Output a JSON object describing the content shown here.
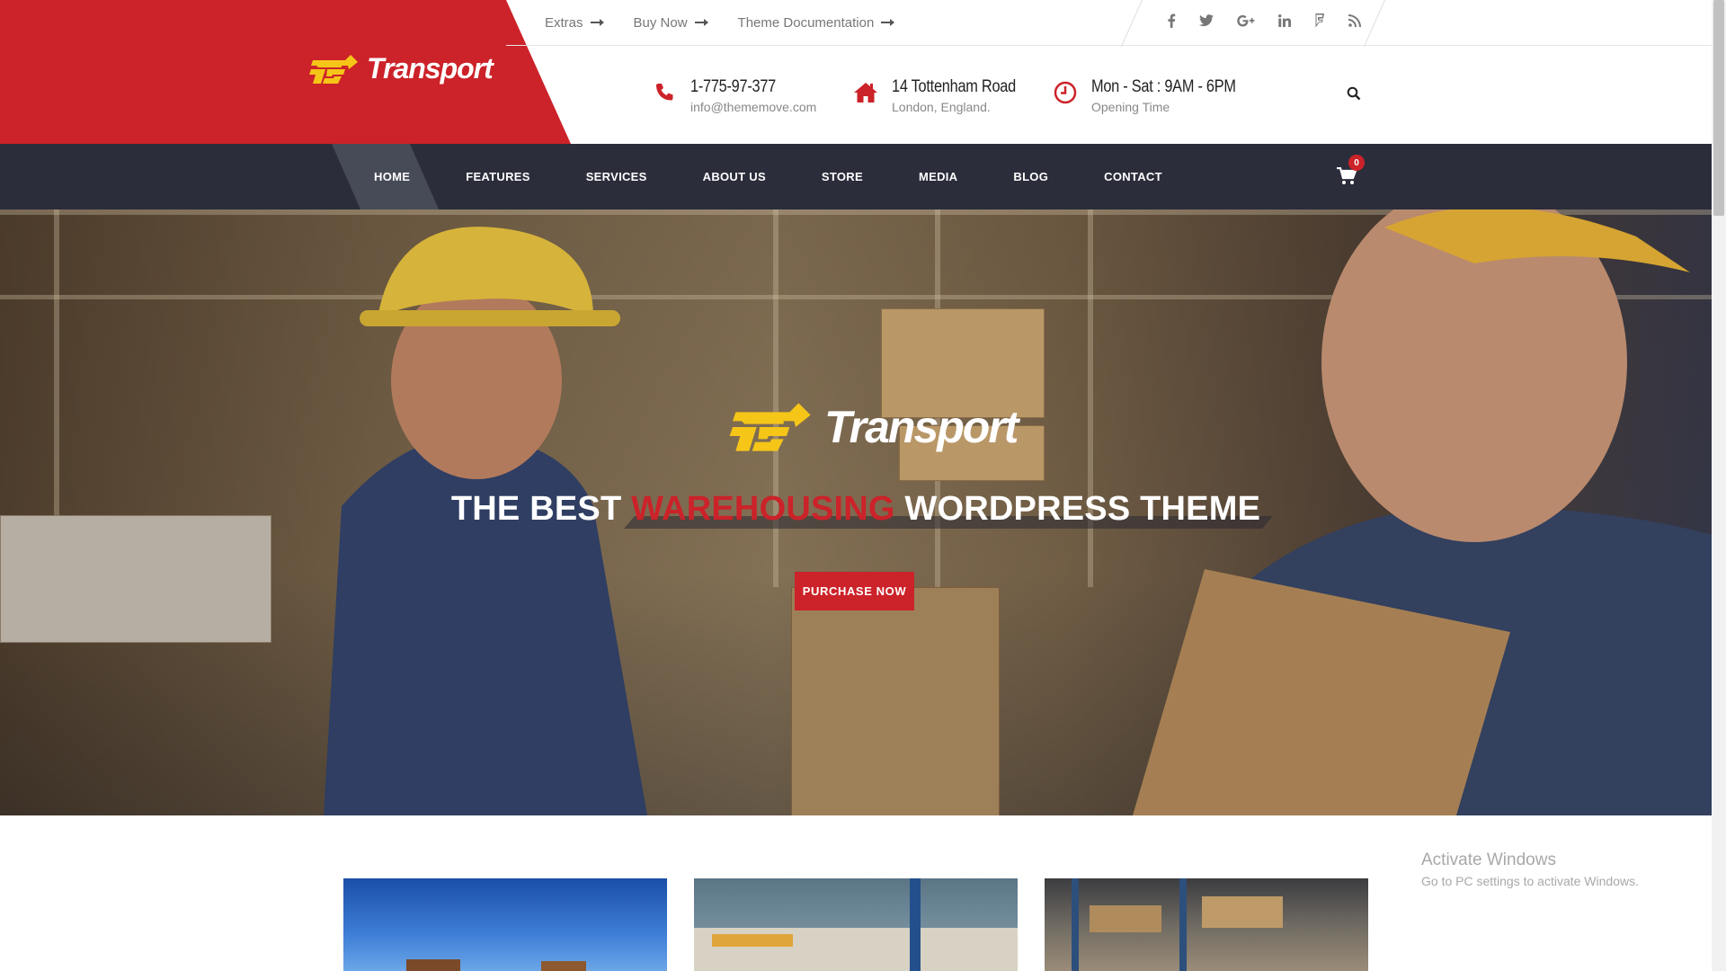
{
  "header": {
    "logo_text": "Transport",
    "logo_mark": "TS",
    "topbar_links": [
      "Extras",
      "Buy Now",
      "Theme Documentation"
    ],
    "social_icons": [
      "facebook-icon",
      "twitter-icon",
      "google-plus-icon",
      "linkedin-icon",
      "foursquare-icon",
      "rss-icon"
    ],
    "phone": {
      "title": "1-775-97-377",
      "sub": "info@thememove.com"
    },
    "address": {
      "title": "14 Tottenham Road",
      "sub": "London, England."
    },
    "hours": {
      "title": "Mon - Sat : 9AM - 6PM",
      "sub": "Opening Time"
    }
  },
  "nav": {
    "items": [
      "HOME",
      "FEATURES",
      "SERVICES",
      "ABOUT US",
      "STORE",
      "MEDIA",
      "BLOG",
      "CONTACT"
    ],
    "active": "HOME",
    "cart_count": "0"
  },
  "hero": {
    "logo_text": "Transport",
    "logo_mark": "TS",
    "title_pre": "THE BEST ",
    "title_highlight": "WAREHOUSING",
    "title_post": " WORDPRESS THEME",
    "button": "PURCHASE NOW"
  },
  "watermark": {
    "line1": "Activate Windows",
    "line2": "Go to PC settings to activate Windows."
  },
  "colors": {
    "brand_red": "#cc2229",
    "nav_bg": "#2b2d3b",
    "logo_yellow": "#f5c518"
  }
}
